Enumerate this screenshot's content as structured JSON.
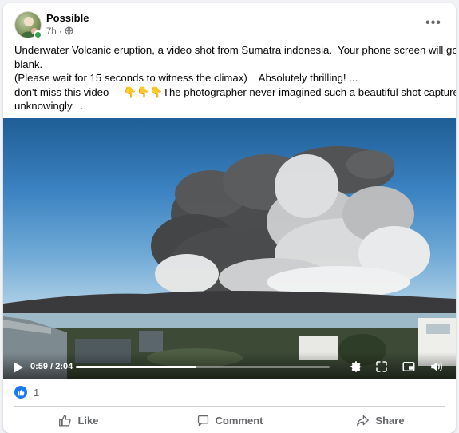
{
  "post": {
    "author": "Possible",
    "time": "7h",
    "privacy_icon": "globe-icon",
    "text_lines": [
      "Underwater Volcanic eruption, a video shot from Sumatra indonesia.  Your phone screen will go",
      "blank.",
      "(Please wait for 15 seconds to witness the climax)    Absolutely thrilling! ...",
      "don't miss this video     👇👇👇The photographer never imagined such a beautiful shot captured",
      "unknowingly.  ."
    ]
  },
  "video": {
    "current_time": "0:59",
    "separator": " / ",
    "duration": "2:04",
    "progress": 0.476
  },
  "reactions": {
    "count": "1",
    "icon": "like-reaction-icon"
  },
  "actions": {
    "like": "Like",
    "comment": "Comment",
    "share": "Share"
  },
  "colors": {
    "accent": "#1877f2",
    "online": "#31a24c",
    "secondary_text": "#65676b"
  }
}
